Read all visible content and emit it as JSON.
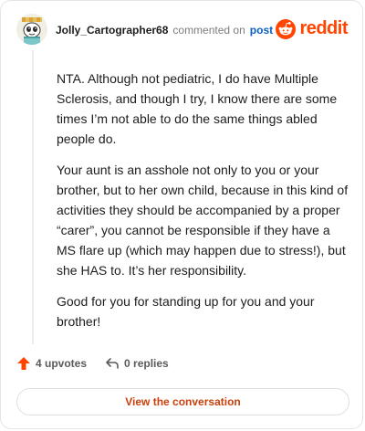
{
  "comment": {
    "username": "Jolly_Cartographer68",
    "action_text": "commented on",
    "post_link": "post",
    "paragraphs": [
      "NTA. Although not pediatric, I do have Multiple Sclerosis, and though I try, I know there are some times I’m not able to do the same things abled people do.",
      "Your aunt is an asshole not only to you or your brother, but to her own child, because in this kind of activities they should be accompanied by a proper “carer”, you cannot be responsible if they have a MS flare up (which may happen due to stress!), but she HAS to. It’s her responsibility.",
      "Good for you for standing up for you and your brother!"
    ]
  },
  "brand": {
    "name": "reddit",
    "icon": "reddit-snoo-icon",
    "color": "#ff4500"
  },
  "actions": {
    "upvotes_label": "4 upvotes",
    "replies_label": "0 replies",
    "upvote_icon": "upvote-arrow-icon",
    "reply_icon": "reply-arrow-icon",
    "upvote_color": "#ff4500"
  },
  "cta": {
    "label": "View the conversation",
    "color": "#c9400c"
  }
}
